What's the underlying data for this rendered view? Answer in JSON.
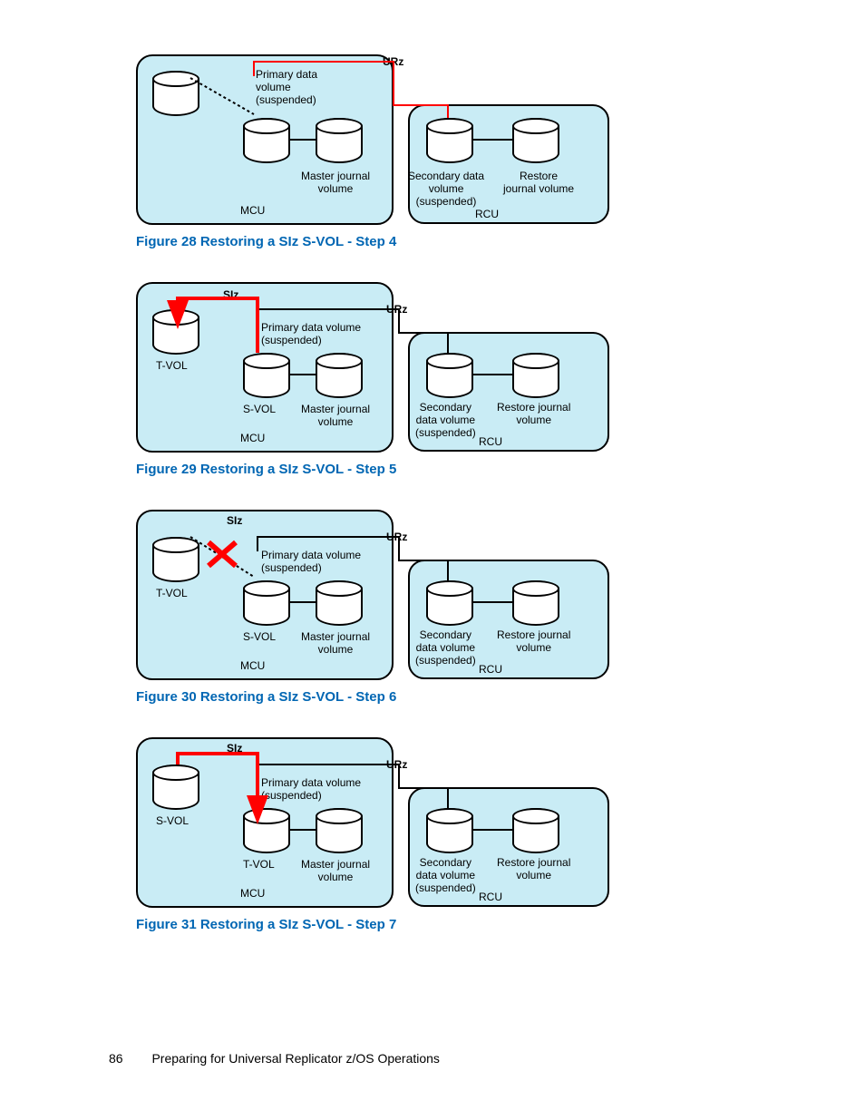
{
  "page_number": "86",
  "footer_text": "Preparing for Universal Replicator z/OS Operations",
  "common": {
    "siz": "SIz",
    "urz": "URz",
    "mcu": "MCU",
    "rcu": "RCU",
    "primary": "Primary data\nvolume\n(suspended)",
    "primary_wide": "Primary data volume\n(suspended)",
    "master": "Master journal\nvolume",
    "secondary": "Secondary data\nvolume\n(suspended)",
    "secondary_nl": "Secondary\ndata volume\n(suspended)",
    "restore": "Restore\njournal volume",
    "restore_nl": "Restore journal\nvolume",
    "tvol": "T-VOL",
    "svol": "S-VOL"
  },
  "figs": [
    {
      "caption": "Figure 28 Restoring a SIz S-VOL - Step 4"
    },
    {
      "caption": "Figure 29 Restoring a SIz S-VOL - Step 5"
    },
    {
      "caption": "Figure 30 Restoring a SIz S-VOL - Step 6"
    },
    {
      "caption": "Figure 31 Restoring a SIz S-VOL - Step 7"
    }
  ]
}
